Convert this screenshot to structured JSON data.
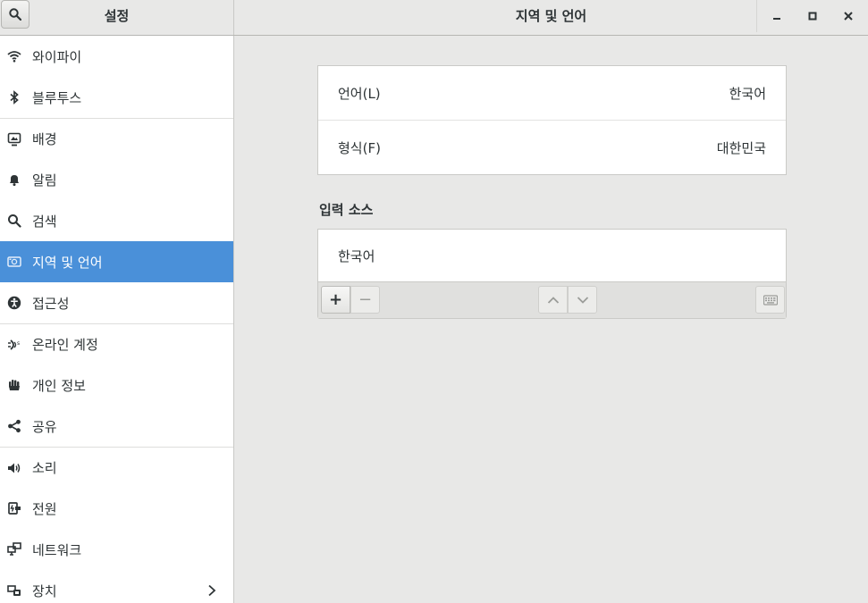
{
  "header": {
    "sidebar_title": "설정",
    "page_title": "지역 및 언어"
  },
  "sidebar": {
    "items": [
      {
        "label": "와이파이",
        "icon": "wifi-icon"
      },
      {
        "label": "블루투스",
        "icon": "bluetooth-icon"
      },
      {
        "label": "배경",
        "icon": "background-icon"
      },
      {
        "label": "알림",
        "icon": "bell-icon"
      },
      {
        "label": "검색",
        "icon": "search-icon"
      },
      {
        "label": "지역 및 언어",
        "icon": "region-icon",
        "active": true
      },
      {
        "label": "접근성",
        "icon": "accessibility-icon"
      },
      {
        "label": "온라인 계정",
        "icon": "online-accounts-icon"
      },
      {
        "label": "개인 정보",
        "icon": "privacy-hand-icon"
      },
      {
        "label": "공유",
        "icon": "share-icon"
      },
      {
        "label": "소리",
        "icon": "speaker-icon"
      },
      {
        "label": "전원",
        "icon": "power-icon"
      },
      {
        "label": "네트워크",
        "icon": "network-icon"
      },
      {
        "label": "장치",
        "icon": "devices-icon"
      }
    ]
  },
  "main": {
    "language": {
      "label": "언어(L)",
      "value": "한국어"
    },
    "formats": {
      "label": "형식(F)",
      "value": "대한민국"
    },
    "input_sources": {
      "title": "입력 소스",
      "items": [
        "한국어"
      ],
      "add_symbol": "+",
      "remove_symbol": "−"
    }
  },
  "colors": {
    "accent": "#4a90d9",
    "window_bg": "#e8e8e7"
  }
}
